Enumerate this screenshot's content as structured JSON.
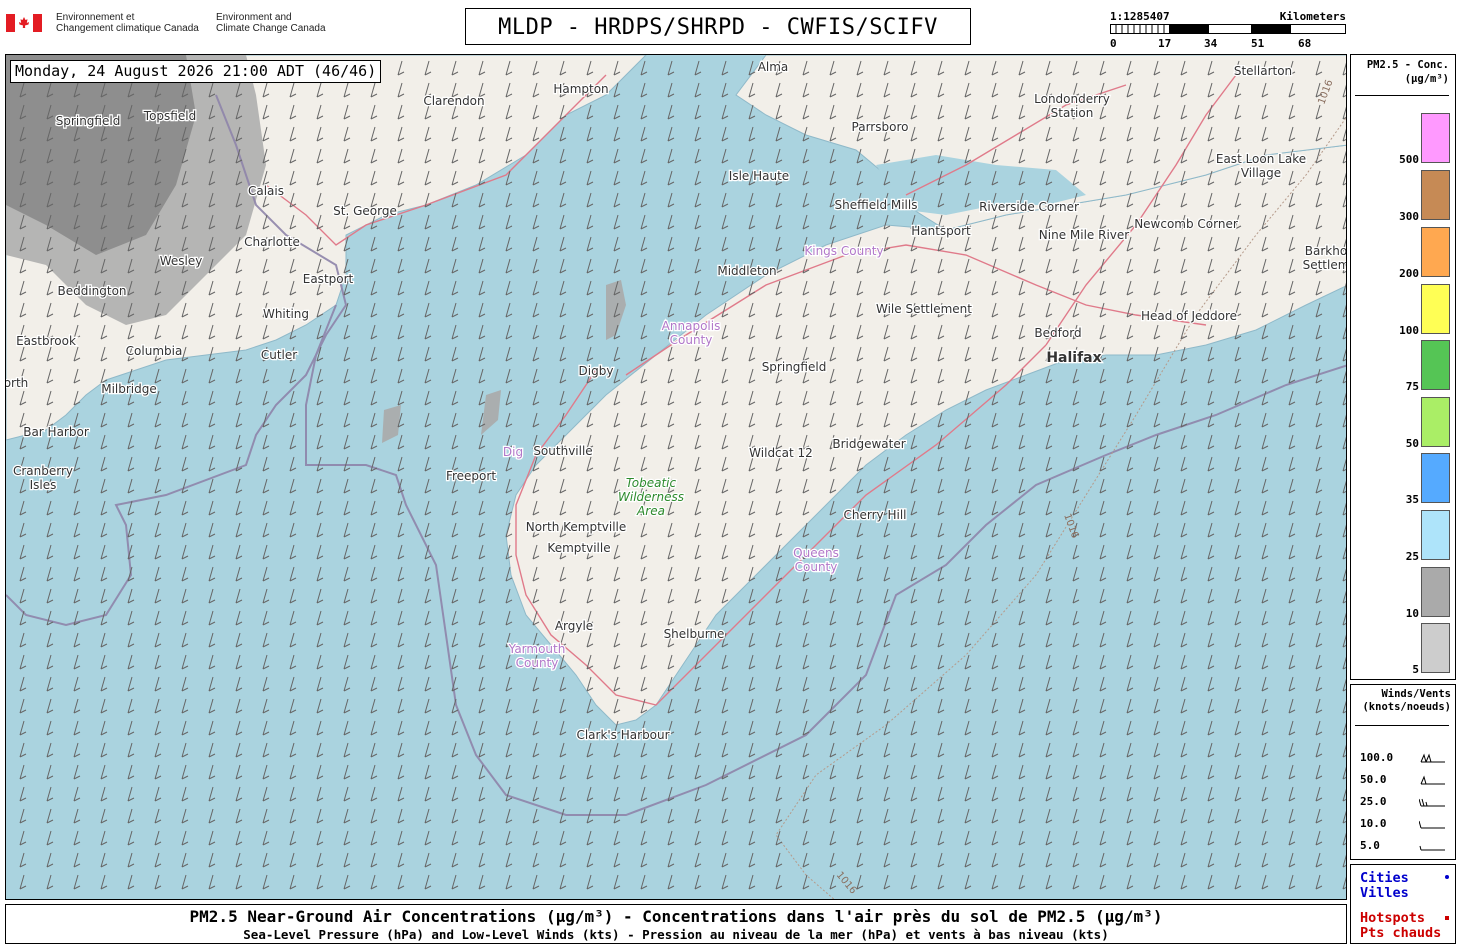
{
  "header": {
    "gov_fr": [
      "Environnement et",
      "Changement climatique Canada"
    ],
    "gov_en": [
      "Environment and",
      "Climate Change Canada"
    ],
    "title": "MLDP - HRDPS/SHRPD - CWFIS/SCIFV",
    "scale": {
      "ratio": "1:1285407",
      "unit": "Kilometers",
      "ticks": [
        "0",
        "17",
        "34",
        "51",
        "68"
      ]
    }
  },
  "map": {
    "timestamp": "Monday, 24 August 2026 21:00 ADT (46/46)",
    "places": [
      {
        "name": "Alma",
        "kind": "city"
      },
      {
        "name": "Stellarton",
        "kind": "city"
      },
      {
        "name": "Hampton",
        "kind": "city"
      },
      {
        "name": "Clarendon",
        "kind": "city"
      },
      {
        "name": "Londonderry Station",
        "kind": "city"
      },
      {
        "name": "Parrsboro",
        "kind": "city"
      },
      {
        "name": "Springfield",
        "kind": "city"
      },
      {
        "name": "Topsfield",
        "kind": "city"
      },
      {
        "name": "East Loon Lake Village",
        "kind": "city"
      },
      {
        "name": "Isle Haute",
        "kind": "city"
      },
      {
        "name": "Calais",
        "kind": "city"
      },
      {
        "name": "St. George",
        "kind": "city"
      },
      {
        "name": "Sheffield Mills",
        "kind": "city"
      },
      {
        "name": "Riverside Corner",
        "kind": "city"
      },
      {
        "name": "Charlotte",
        "kind": "city"
      },
      {
        "name": "Hantsport",
        "kind": "city"
      },
      {
        "name": "Nine Mile River",
        "kind": "city"
      },
      {
        "name": "Newcomb Corner",
        "kind": "city"
      },
      {
        "name": "Kings County",
        "kind": "county"
      },
      {
        "name": "Wesley",
        "kind": "city"
      },
      {
        "name": "Middleton",
        "kind": "city"
      },
      {
        "name": "Barkho Settlem",
        "kind": "city"
      },
      {
        "name": "Eastport",
        "kind": "city"
      },
      {
        "name": "Beddington",
        "kind": "city"
      },
      {
        "name": "Wile Settlement",
        "kind": "city"
      },
      {
        "name": "Whiting",
        "kind": "city"
      },
      {
        "name": "Annapolis County",
        "kind": "county"
      },
      {
        "name": "Head of Jeddore",
        "kind": "city"
      },
      {
        "name": "Bedford",
        "kind": "city"
      },
      {
        "name": "Eastbrook",
        "kind": "city"
      },
      {
        "name": "Halifax",
        "kind": "major"
      },
      {
        "name": "Columbia",
        "kind": "city"
      },
      {
        "name": "Cutler",
        "kind": "city"
      },
      {
        "name": "Springfield",
        "kind": "city"
      },
      {
        "name": "Digby",
        "kind": "city"
      },
      {
        "name": "orth",
        "kind": "city"
      },
      {
        "name": "Milbridge",
        "kind": "city"
      },
      {
        "name": "Bar Harbor",
        "kind": "city"
      },
      {
        "name": "Bridgewater",
        "kind": "city"
      },
      {
        "name": "Dig",
        "kind": "county"
      },
      {
        "name": "Southville",
        "kind": "city"
      },
      {
        "name": "Wildcat 12",
        "kind": "city"
      },
      {
        "name": "Cranberry Isles",
        "kind": "city"
      },
      {
        "name": "Tobeatic Wilderness Area",
        "kind": "park"
      },
      {
        "name": "Freeport",
        "kind": "city"
      },
      {
        "name": "Cherry Hill",
        "kind": "city"
      },
      {
        "name": "North Kemptville",
        "kind": "city"
      },
      {
        "name": "Kemptville",
        "kind": "city"
      },
      {
        "name": "Queens County",
        "kind": "county"
      },
      {
        "name": "Argyle",
        "kind": "city"
      },
      {
        "name": "Yarmouth County",
        "kind": "county"
      },
      {
        "name": "Shelburne",
        "kind": "city"
      },
      {
        "name": "Clark's Harbour",
        "kind": "city"
      }
    ],
    "isobar_labels": [
      "1016",
      "1016",
      "1016"
    ]
  },
  "legend": {
    "title": [
      "PM2.5 - Conc.",
      "(µg/m³)"
    ],
    "levels": [
      {
        "label": "500",
        "color": "#ff99ff"
      },
      {
        "label": "300",
        "color": "#c68a55"
      },
      {
        "label": "200",
        "color": "#ffa850"
      },
      {
        "label": "100",
        "color": "#ffff55"
      },
      {
        "label": "75",
        "color": "#55c555"
      },
      {
        "label": "50",
        "color": "#aaee66"
      },
      {
        "label": "35",
        "color": "#55aaff"
      },
      {
        "label": "25",
        "color": "#aee4fa"
      },
      {
        "label": "10",
        "color": "#aaaaaa"
      },
      {
        "label": "5",
        "color": "#cdcdcd"
      }
    ]
  },
  "winds_legend": {
    "title": [
      "Winds/Vents",
      "(knots/noeuds)"
    ],
    "rows": [
      {
        "label": "100.0",
        "pennants": 2,
        "barbs": 0,
        "half": 0
      },
      {
        "label": "50.0",
        "pennants": 1,
        "barbs": 0,
        "half": 0
      },
      {
        "label": "25.0",
        "pennants": 0,
        "barbs": 2,
        "half": 1
      },
      {
        "label": "10.0",
        "pennants": 0,
        "barbs": 1,
        "half": 0
      },
      {
        "label": "5.0",
        "pennants": 0,
        "barbs": 0,
        "half": 1
      }
    ]
  },
  "key": {
    "cities": [
      "Cities",
      "Villes"
    ],
    "hotspots": [
      "Hotspots",
      "Pts chauds"
    ],
    "cities_color": "#0000cc",
    "hotspots_color": "#cc0000"
  },
  "footer": {
    "line1": "PM2.5 Near-Ground Air Concentrations (µg/m³) - Concentrations dans l'air près du sol de PM2.5 (µg/m³)",
    "line2": "Sea-Level Pressure (hPa) and Low-Level Winds (kts) - Pression au niveau de la mer (hPa) et vents à bas niveau (kts)"
  },
  "colors": {
    "water": "#aad3df",
    "land": "#f2efe9",
    "isobar": "#9a8fb0",
    "road": "#e07a8a"
  }
}
